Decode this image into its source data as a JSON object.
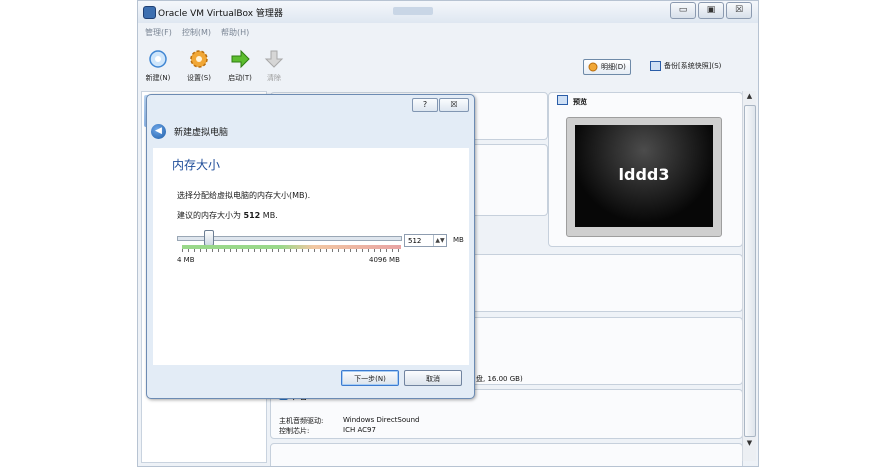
{
  "window": {
    "title": "Oracle VM VirtualBox 管理器",
    "controls": {
      "minimize": "▭",
      "maximize": "▣",
      "close": "☒"
    }
  },
  "menubar": [
    "管理(F)",
    "控制(M)",
    "帮助(H)"
  ],
  "toolbar": {
    "buttons": [
      {
        "label": "新建(N)",
        "icon": "new-icon"
      },
      {
        "label": "设置(S)",
        "icon": "settings-gear-icon"
      },
      {
        "label": "启动(T)",
        "icon": "start-arrow-icon"
      },
      {
        "label": "清除",
        "icon": "discard-arrow-icon",
        "disabled": true
      }
    ],
    "details_label": "明细(D)",
    "snapshots_label": "备份[系统快照](S)"
  },
  "preview": {
    "title": "预览",
    "vm_name": "lddd3"
  },
  "details": {
    "storage_tail": "盘, 16.00 GB)",
    "audio_title": "声音",
    "audio_driver_label": "主机音频驱动:",
    "audio_driver_value": "Windows DirectSound",
    "audio_controller_label": "控制芯片:",
    "audio_controller_value": "ICH AC97"
  },
  "dialog": {
    "help_glyph": "?",
    "close_glyph": "☒",
    "nav_title": "新建虚拟电脑",
    "section_title": "内存大小",
    "description": "选择分配给虚拟电脑的内存大小(MB).",
    "recommend_prefix": "建议的内存大小为",
    "recommend_value": "512",
    "recommend_suffix": "MB.",
    "memory_value": "512",
    "memory_unit": "MB",
    "min_label": "4 MB",
    "max_label": "4096 MB",
    "next_button": "下一步(N)",
    "cancel_button": "取消"
  },
  "memory_slider": {
    "min": 4,
    "max": 4096,
    "value": 512
  }
}
